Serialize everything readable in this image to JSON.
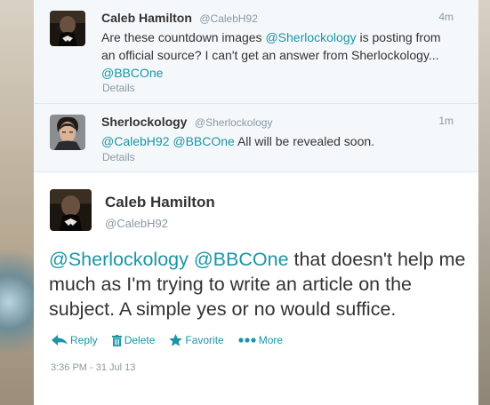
{
  "conversation": [
    {
      "name": "Caleb Hamilton",
      "handle": "@CalebH92",
      "time": "4m",
      "text_parts": [
        {
          "text": "Are these countdown images ",
          "mention": false
        },
        {
          "text": "@Sherlockology",
          "mention": true
        },
        {
          "text": " is posting from an official source? I can't get an answer from Sherlockology... ",
          "mention": false
        },
        {
          "text": "@BBCOne",
          "mention": true
        }
      ],
      "details": "Details"
    },
    {
      "name": "Sherlockology",
      "handle": "@Sherlockology",
      "time": "1m",
      "text_parts": [
        {
          "text": "@CalebH92",
          "mention": true
        },
        {
          "text": " ",
          "mention": false
        },
        {
          "text": "@BBCOne",
          "mention": true
        },
        {
          "text": " All will be revealed soon.",
          "mention": false
        }
      ],
      "details": "Details"
    }
  ],
  "main": {
    "name": "Caleb Hamilton",
    "handle": "@CalebH92",
    "text_parts": [
      {
        "text": "@Sherlockology",
        "mention": true
      },
      {
        "text": " ",
        "mention": false
      },
      {
        "text": "@BBCOne",
        "mention": true
      },
      {
        "text": " that doesn't help me much as I'm trying to write an article on the subject. A simple yes or no would suffice.",
        "mention": false
      }
    ],
    "actions": {
      "reply": "Reply",
      "delete": "Delete",
      "favorite": "Favorite",
      "more": "More"
    },
    "timestamp": "3:36 PM - 31 Jul 13"
  },
  "colors": {
    "link": "#1b95a6",
    "muted": "#8899a6",
    "text": "#333333"
  }
}
